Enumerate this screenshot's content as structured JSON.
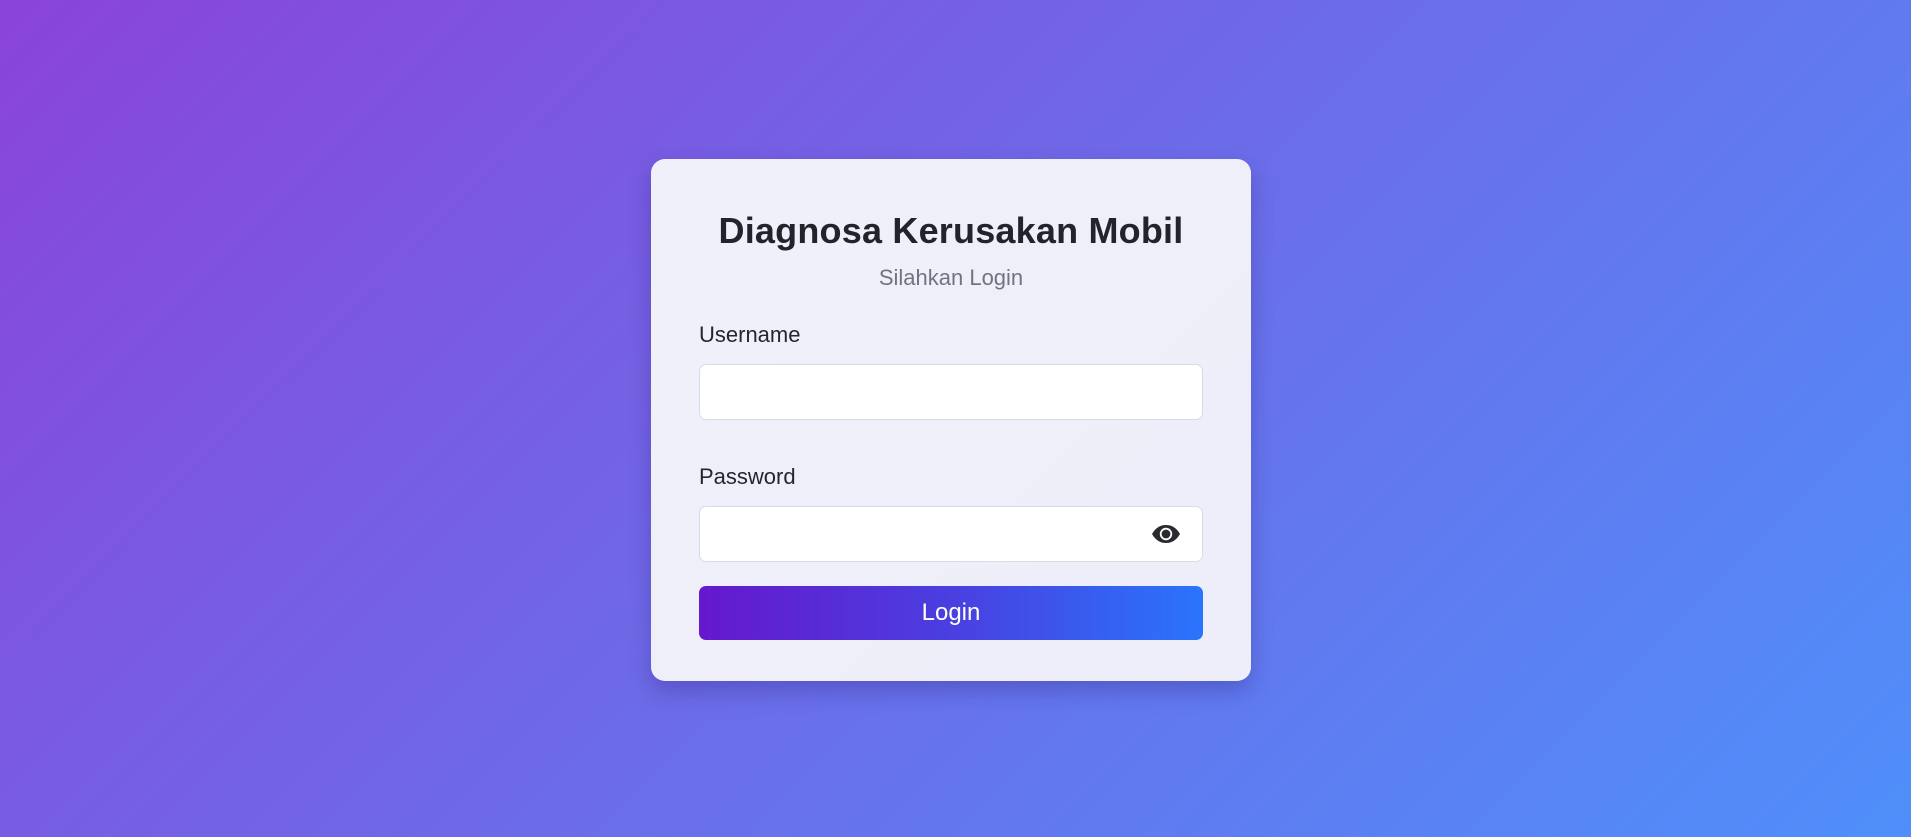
{
  "login_card": {
    "title": "Diagnosa Kerusakan Mobil",
    "subtitle": "Silahkan Login",
    "username": {
      "label": "Username",
      "value": "",
      "placeholder": ""
    },
    "password": {
      "label": "Password",
      "value": "",
      "placeholder": "",
      "toggle_icon": "eye-icon"
    },
    "submit_label": "Login"
  },
  "colors": {
    "background_gradient_start": "#8a44d8",
    "background_gradient_end": "#4f8ffb",
    "card_background": "#f0f0fa",
    "button_gradient_start": "#6518cc",
    "button_gradient_end": "#2a74fb",
    "title_text": "#23232b",
    "subtitle_text": "#6f7480"
  }
}
